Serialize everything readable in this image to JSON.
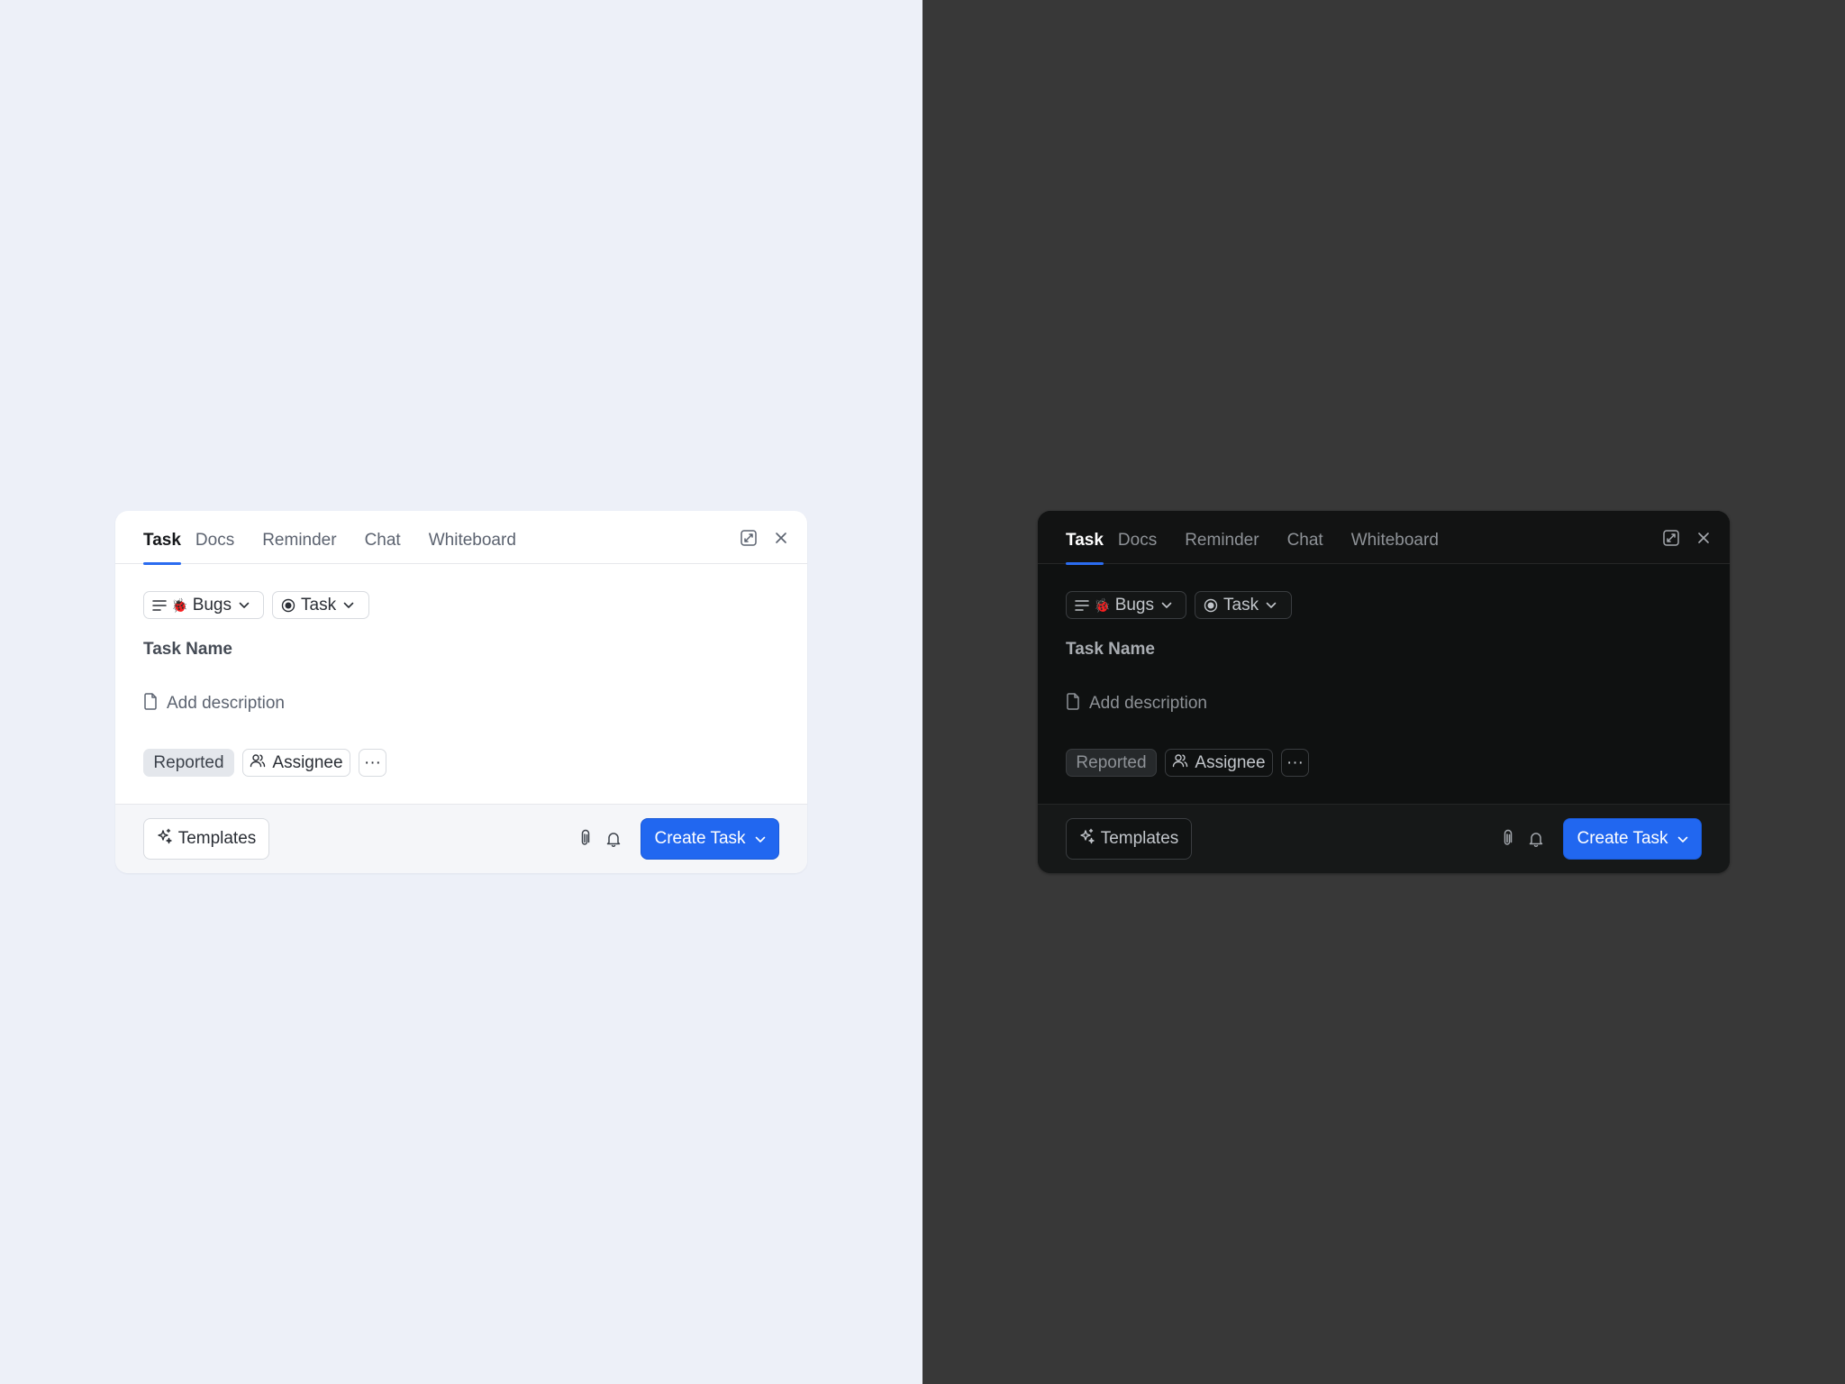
{
  "tabs": [
    {
      "label": "Task",
      "active": true
    },
    {
      "label": "Docs"
    },
    {
      "label": "Reminder"
    },
    {
      "label": "Chat"
    },
    {
      "label": "Whiteboard"
    }
  ],
  "header": {
    "expand_icon": "expand-icon",
    "close_icon": "close-icon"
  },
  "chips": {
    "list_icon": "list-lines-icon",
    "list_emoji": "🐞",
    "list_label": "Bugs",
    "status_icon": "radio-dot-icon",
    "status_label": "Task"
  },
  "form": {
    "task_name_placeholder": "Task Name",
    "description_placeholder": "Add description",
    "description_icon": "document-icon"
  },
  "pills": {
    "reported": "Reported",
    "assignee": "Assignee",
    "assignee_icon": "users-icon",
    "more": "···"
  },
  "footer": {
    "templates": "Templates",
    "templates_icon": "sparkle-icon",
    "attach_icon": "paperclip-icon",
    "bell_icon": "bell-icon",
    "create": "Create Task"
  },
  "colors": {
    "light_background": "#edf0f8",
    "dark_background": "#383838",
    "accent": "#2167f0"
  }
}
